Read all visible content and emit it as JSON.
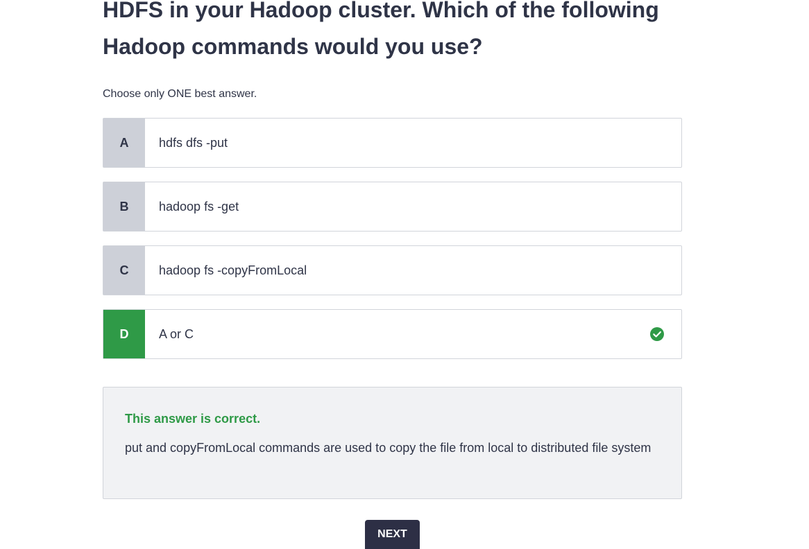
{
  "question": {
    "text": "HDFS in your Hadoop cluster. Which of the following Hadoop commands would you use?",
    "instruction": "Choose only ONE best answer."
  },
  "options": [
    {
      "letter": "A",
      "text": "hdfs dfs -put"
    },
    {
      "letter": "B",
      "text": "hadoop fs -get"
    },
    {
      "letter": "C",
      "text": "hadoop fs -copyFromLocal"
    },
    {
      "letter": "D",
      "text": "A or C"
    }
  ],
  "selected_option": "D",
  "icons": {
    "correct_mark": "check-circle-icon"
  },
  "feedback": {
    "title": "This answer is correct.",
    "body": "put and copyFromLocal commands are used to copy the file from local to distributed file system"
  },
  "actions": {
    "next_label": "NEXT"
  },
  "colors": {
    "correct": "#2f9a47",
    "letter_bg": "#cdd0d8",
    "text": "#2f3447",
    "button_bg": "#2d2f45",
    "feedback_bg": "#f1f2f4"
  }
}
